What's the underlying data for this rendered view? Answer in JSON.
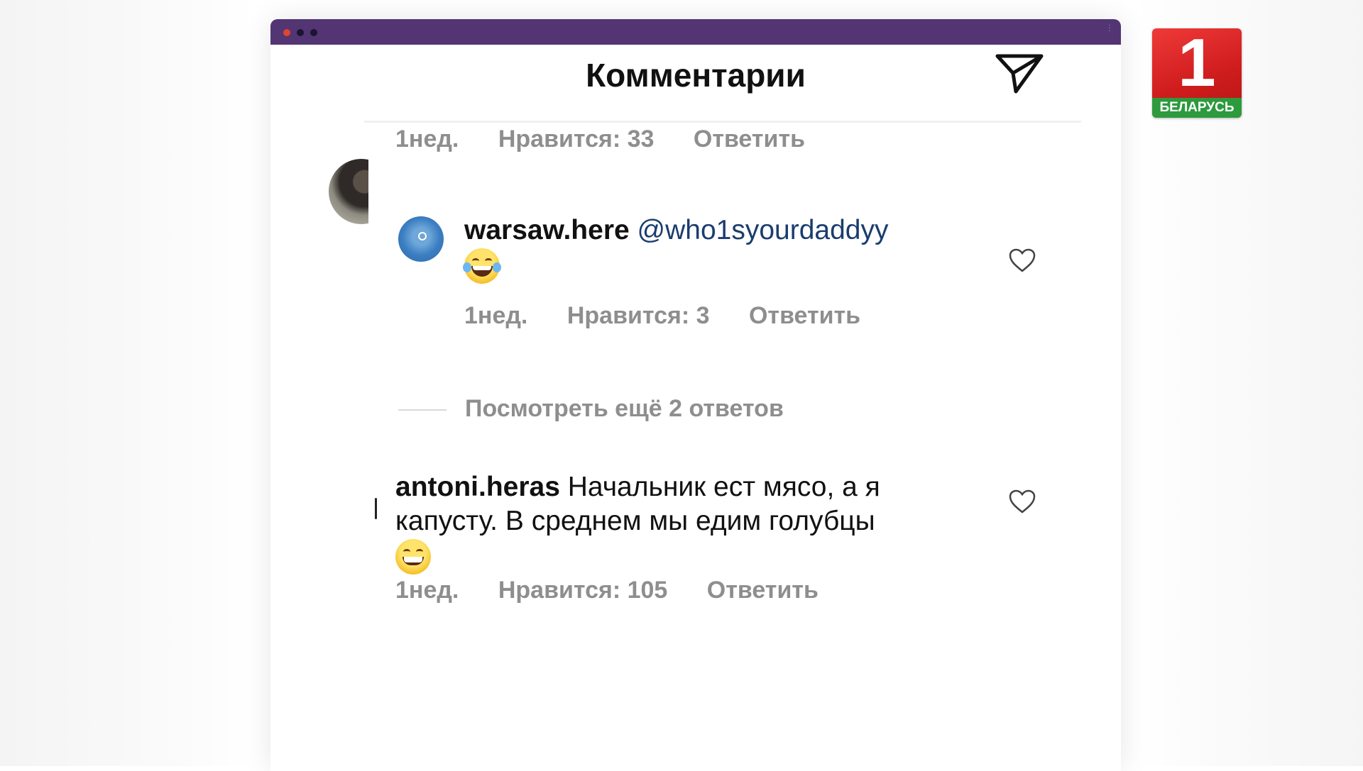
{
  "header": {
    "title": "Комментарии",
    "send_icon": "send-icon"
  },
  "comments": [
    {
      "age": "1нед.",
      "likes": "Нравится: 33",
      "reply": "Ответить"
    },
    {
      "username": "warsaw.here",
      "mention": "@who1syourdaddyy",
      "emoji": "face-with-tears-of-joy",
      "age": "1нед.",
      "likes": "Нравится: 3",
      "reply": "Ответить"
    },
    {
      "username": "antoni.heras",
      "text": "Начальник ест мясо, а я капусту. В среднем мы едим голубцы",
      "emoji": "grinning-face",
      "age": "1нед.",
      "likes": "Нравится: 105",
      "reply": "Ответить"
    }
  ],
  "view_more": "Посмотреть ещё 2 ответов",
  "logo": {
    "number": "1",
    "band": "БЕЛАРУСЬ",
    "colors": {
      "red": "#e02a2a",
      "green": "#2c9a3d"
    }
  },
  "window": {
    "titlebar_color": "#523572"
  }
}
